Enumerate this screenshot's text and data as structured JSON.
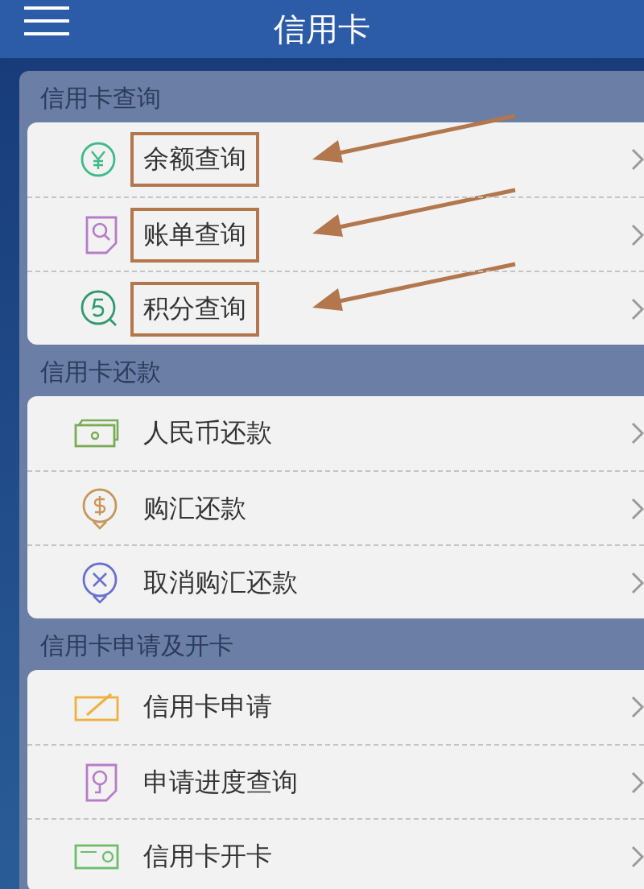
{
  "header": {
    "title": "信用卡"
  },
  "sections": [
    {
      "title": "信用卡查询",
      "items": [
        {
          "label": "余额查询",
          "annotated": true
        },
        {
          "label": "账单查询",
          "annotated": true
        },
        {
          "label": "积分查询",
          "annotated": true
        }
      ]
    },
    {
      "title": "信用卡还款",
      "items": [
        {
          "label": "人民币还款",
          "annotated": false
        },
        {
          "label": "购汇还款",
          "annotated": false
        },
        {
          "label": "取消购汇还款",
          "annotated": false
        }
      ]
    },
    {
      "title": "信用卡申请及开卡",
      "items": [
        {
          "label": "信用卡申请",
          "annotated": false
        },
        {
          "label": "申请进度查询",
          "annotated": false
        },
        {
          "label": "信用卡开卡",
          "annotated": false
        }
      ]
    }
  ]
}
